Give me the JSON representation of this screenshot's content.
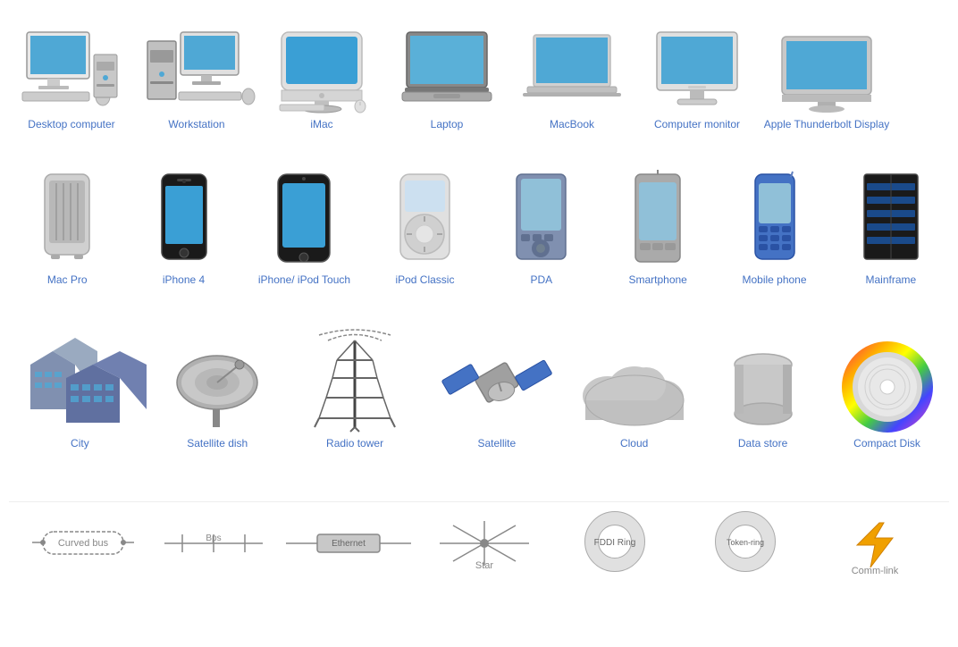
{
  "rows": [
    {
      "id": "row1",
      "items": [
        {
          "id": "desktop-computer",
          "label": "Desktop computer",
          "icon": "desktop"
        },
        {
          "id": "workstation",
          "label": "Workstation",
          "icon": "workstation"
        },
        {
          "id": "imac",
          "label": "iMac",
          "icon": "imac"
        },
        {
          "id": "laptop",
          "label": "Laptop",
          "icon": "laptop"
        },
        {
          "id": "macbook",
          "label": "MacBook",
          "icon": "macbook"
        },
        {
          "id": "computer-monitor",
          "label": "Computer monitor",
          "icon": "monitor"
        },
        {
          "id": "apple-thunderbolt",
          "label": "Apple Thunderbolt Display",
          "icon": "thunderbolt"
        }
      ]
    },
    {
      "id": "row2",
      "items": [
        {
          "id": "mac-pro",
          "label": "Mac Pro",
          "icon": "macpro"
        },
        {
          "id": "iphone4",
          "label": "iPhone 4",
          "icon": "iphone4"
        },
        {
          "id": "ipod-touch",
          "label": "iPhone/ iPod Touch",
          "icon": "ipodtouch"
        },
        {
          "id": "ipod-classic",
          "label": "iPod Classic",
          "icon": "ipodclassic"
        },
        {
          "id": "pda",
          "label": "PDA",
          "icon": "pda"
        },
        {
          "id": "smartphone",
          "label": "Smartphone",
          "icon": "smartphone"
        },
        {
          "id": "mobile-phone",
          "label": "Mobile phone",
          "icon": "mobilephone"
        },
        {
          "id": "mainframe",
          "label": "Mainframe",
          "icon": "mainframe"
        }
      ]
    },
    {
      "id": "row3",
      "items": [
        {
          "id": "city",
          "label": "City",
          "icon": "city"
        },
        {
          "id": "satellite-dish",
          "label": "Satellite dish",
          "icon": "satellitedish"
        },
        {
          "id": "radio-tower",
          "label": "Radio tower",
          "icon": "radiotower"
        },
        {
          "id": "satellite",
          "label": "Satellite",
          "icon": "satellite"
        },
        {
          "id": "cloud",
          "label": "Cloud",
          "icon": "cloud"
        },
        {
          "id": "data-store",
          "label": "Data store",
          "icon": "datastore"
        },
        {
          "id": "compact-disk",
          "label": "Compact Disk",
          "icon": "compactdisk"
        }
      ]
    }
  ],
  "bottomBar": [
    {
      "id": "curved-bus",
      "label": "Curved bus",
      "icon": "curvedbus"
    },
    {
      "id": "bps",
      "label": "Bps",
      "icon": "bps"
    },
    {
      "id": "ethernet",
      "label": "Ethernet",
      "icon": "ethernet"
    },
    {
      "id": "star",
      "label": "Star",
      "icon": "star"
    },
    {
      "id": "fddi-ring",
      "label": "FDDI Ring",
      "icon": "fddiRing"
    },
    {
      "id": "token-ring",
      "label": "Token-ring",
      "icon": "tokenRing"
    },
    {
      "id": "comm-link",
      "label": "Comm-link",
      "icon": "commLink"
    }
  ]
}
